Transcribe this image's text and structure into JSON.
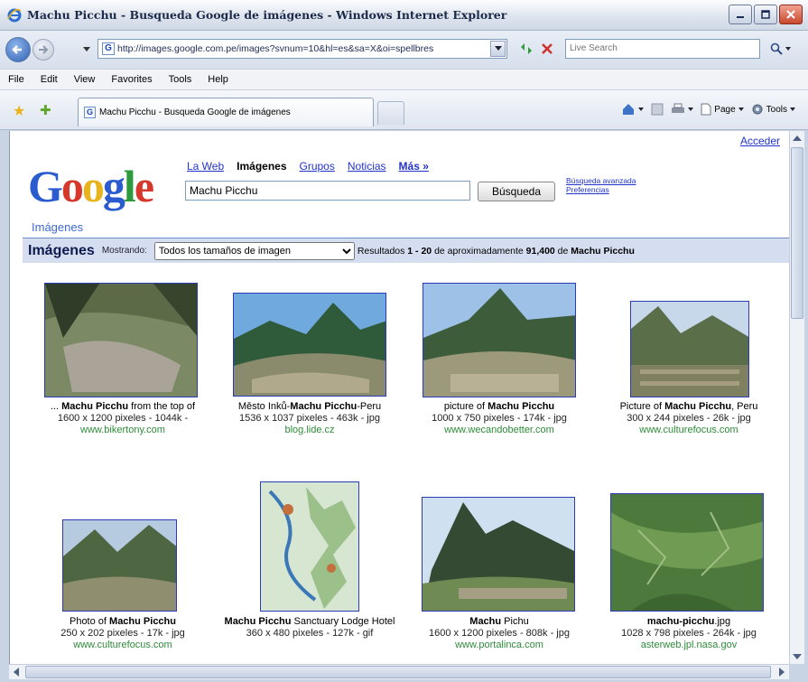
{
  "window": {
    "title": "Machu Picchu - Busqueda Google de imágenes - Windows Internet Explorer"
  },
  "address_bar": {
    "url": "http://images.google.com.pe/images?svnum=10&hl=es&sa=X&oi=spellbres",
    "search_placeholder": "Live Search"
  },
  "menu": {
    "items": [
      "File",
      "Edit",
      "View",
      "Favorites",
      "Tools",
      "Help"
    ]
  },
  "tab": {
    "title": "Machu Picchu - Busqueda Google de imágenes"
  },
  "command_bar": {
    "page_label": "Page",
    "tools_label": "Tools"
  },
  "page": {
    "acceder": "Acceder",
    "logo_text": "Google",
    "logo_sub": "Imágenes",
    "nav": {
      "web": "La Web",
      "imagenes": "Imágenes",
      "grupos": "Grupos",
      "noticias": "Noticias",
      "mas": "Más »"
    },
    "query": "Machu Picchu",
    "search_button": "Búsqueda",
    "advanced": "Búsqueda avanzada",
    "preferences": "Preferencias",
    "results_bar": {
      "heading": "Imágenes",
      "mostrando": "Mostrando:",
      "size_filter": "Todos los tamaños de imagen",
      "results_prefix": "Resultados ",
      "range": "1 - 20",
      "approx": " de aproximadamente ",
      "count": "91,400",
      "de": " de ",
      "query": "Machu Picchu"
    },
    "results": [
      {
        "pre": "... ",
        "bold": "Machu Picchu",
        "post": " from the top of",
        "meta": "1600 x 1200 pixeles - 1044k -",
        "site": "www.bikertony.com"
      },
      {
        "pre": "Město Inků-",
        "bold": "Machu Picchu",
        "post": "-Peru",
        "meta": "1536 x 1037 pixeles - 463k - jpg",
        "site": "blog.lide.cz"
      },
      {
        "pre": "picture of ",
        "bold": "Machu Picchu",
        "post": "",
        "meta": "1000 x 750 pixeles - 174k - jpg",
        "site": "www.wecandobetter.com"
      },
      {
        "pre": "Picture of ",
        "bold": "Machu Picchu",
        "post": ", Peru",
        "meta": "300 x 244 pixeles - 26k - jpg",
        "site": "www.culturefocus.com"
      },
      {
        "pre": "Photo of ",
        "bold": "Machu Picchu",
        "post": "",
        "meta": "250 x 202 pixeles - 17k - jpg",
        "site": "www.culturefocus.com"
      },
      {
        "pre": "",
        "bold": "Machu Picchu",
        "post": " Sanctuary Lodge Hotel",
        "meta": "360 x 480 pixeles - 127k - gif",
        "site": ""
      },
      {
        "pre": "",
        "bold": "Machu",
        "post": " Pichu",
        "meta": "1600 x 1200 pixeles - 808k - jpg",
        "site": "www.portalinca.com"
      },
      {
        "pre": "",
        "bold": "machu-picchu",
        "post": ".jpg",
        "meta": "1028 x 798 pixeles - 264k - jpg",
        "site": "asterweb.jpl.nasa.gov"
      }
    ]
  },
  "colors": {
    "link": "#2233cc",
    "site_green": "#2e8b3a",
    "results_bar": "#d5def0"
  }
}
